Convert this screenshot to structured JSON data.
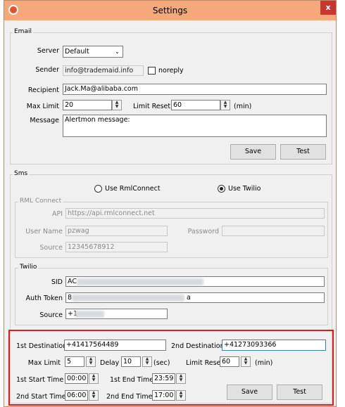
{
  "window": {
    "title": "Settings",
    "close_label": "x"
  },
  "email": {
    "group_label": "Email",
    "server_label": "Server",
    "server_value": "Default",
    "sender_label": "Sender",
    "sender_value": "info@trademaid.info",
    "noreply_label": "noreply",
    "recipient_label": "Recipient",
    "recipient_value": "Jack.Ma@alibaba.com",
    "max_limit_label": "Max Limit",
    "max_limit_value": "20",
    "limit_reset_label": "Limit Reset",
    "limit_reset_value": "60",
    "limit_reset_unit": "(min)",
    "message_label": "Message",
    "message_value": "Alertmon message:",
    "save_label": "Save",
    "test_label": "Test"
  },
  "sms": {
    "group_label": "Sms",
    "use_rmlconnect_label": "Use RmlConnect",
    "use_twilio_label": "Use Twilio",
    "rml": {
      "group_label": "RML Connect",
      "api_label": "API",
      "api_value": "https://api.rmlconnect.net",
      "user_name_label": "User Name",
      "user_name_value": "pzwag",
      "password_label": "Password",
      "password_value": "",
      "source_label": "Source",
      "source_value": "12345678912"
    },
    "twilio": {
      "group_label": "Twilio",
      "sid_label": "SID",
      "sid_value": "AC",
      "auth_token_label": "Auth Token",
      "auth_token_value": "8",
      "auth_token_tail": "a",
      "source_label": "Source",
      "source_value": "+1"
    },
    "dest": {
      "first_dest_label": "1st Destination",
      "first_dest_value": "+41417564489",
      "second_dest_label": "2nd Destination",
      "second_dest_value": "+41273093366",
      "max_limit_label": "Max Limit",
      "max_limit_value": "5",
      "delay_label": "Delay",
      "delay_value": "10",
      "delay_unit": "(sec)",
      "limit_reset_label": "Limit Reset",
      "limit_reset_value": "60",
      "limit_reset_unit": "(min)",
      "first_start_label": "1st Start Time",
      "first_start_value": "00:00",
      "first_end_label": "1st End Time",
      "first_end_value": "23:59",
      "second_start_label": "2nd Start Time",
      "second_start_value": "06:00",
      "second_end_label": "2nd End Time",
      "second_end_value": "17:00",
      "save_label": "Save",
      "test_label": "Test"
    }
  },
  "colors": {
    "title_bar": "#f5a97a",
    "close_button": "#c7372f",
    "highlight": "#e1191a",
    "focus_border": "#3c7fb1"
  }
}
